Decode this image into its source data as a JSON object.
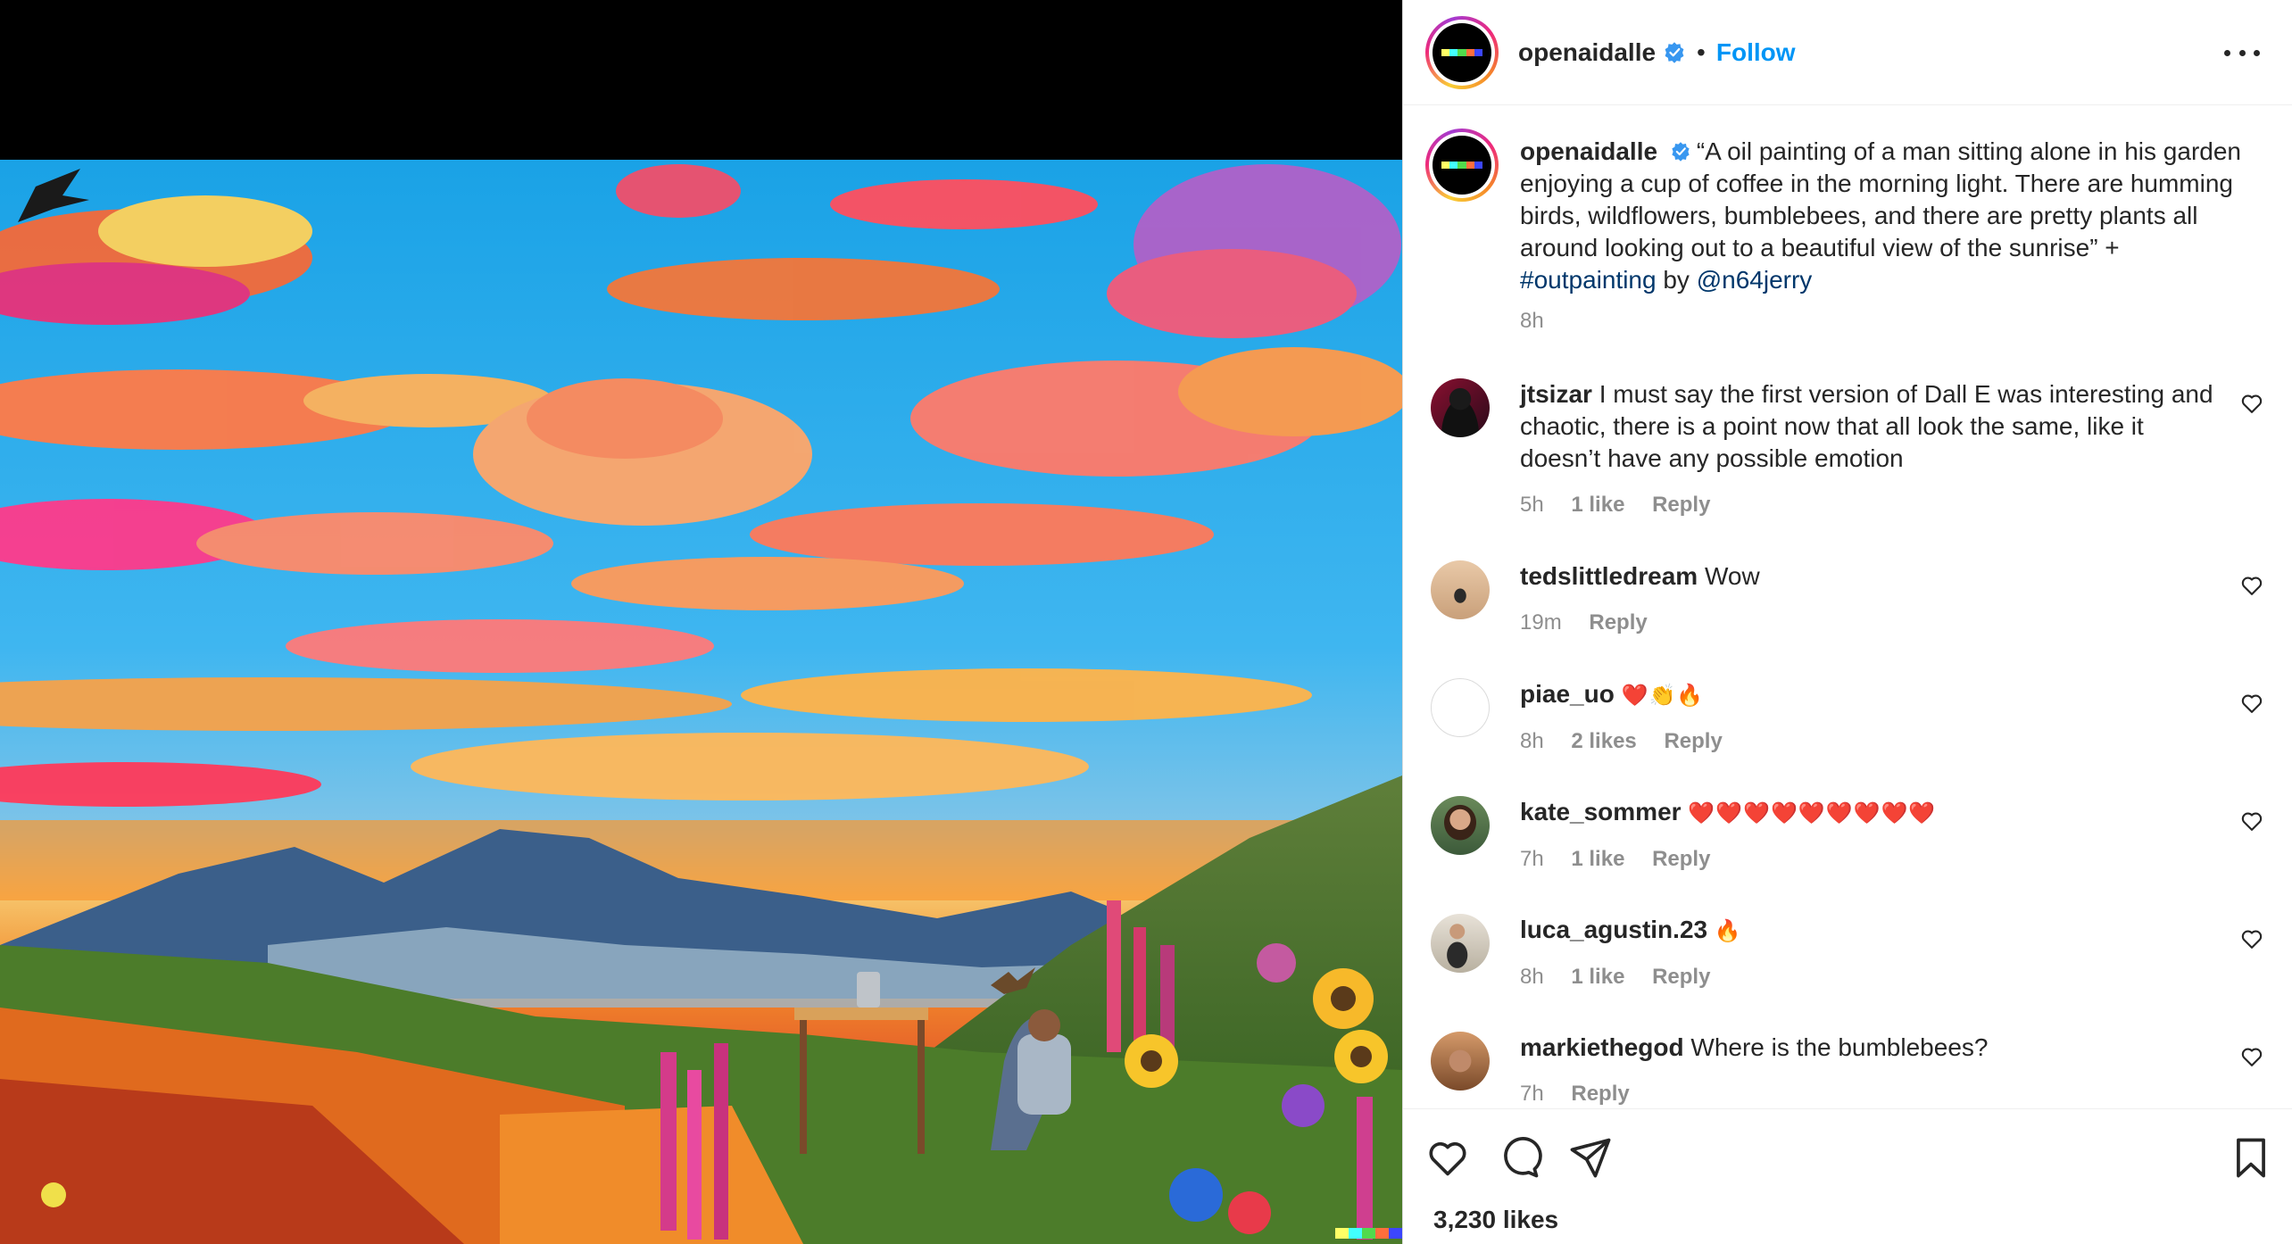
{
  "post": {
    "author": "openaidalle",
    "follow_label": "Follow",
    "separator": "•",
    "caption_text": "“A oil painting of a man sitting alone in his garden enjoying a cup of coffee in the morning light. There are humming birds, wildflowers, bumblebees, and there are pretty plants all around looking out to a beautiful view of the sunrise” + ",
    "hashtag": "#outpainting",
    "by_text": " by ",
    "mention": "@n64jerry",
    "caption_time": "8h",
    "likes_count": "3,230 likes"
  },
  "comments": [
    {
      "user": "jtsizar",
      "text": "I must say the first version of Dall E was interesting and chaotic, there is a point now that all look the same, like it doesn’t have any possible emotion",
      "time": "5h",
      "likes": "1 like",
      "reply": "Reply"
    },
    {
      "user": "tedslittledream",
      "text": "Wow",
      "time": "19m",
      "likes": "",
      "reply": "Reply"
    },
    {
      "user": "piae_uo",
      "text": "❤️👏🔥",
      "time": "8h",
      "likes": "2 likes",
      "reply": "Reply"
    },
    {
      "user": "kate_sommer",
      "text": "❤️❤️❤️❤️❤️❤️❤️❤️❤️",
      "time": "7h",
      "likes": "1 like",
      "reply": "Reply"
    },
    {
      "user": "luca_agustin.23",
      "text": "🔥",
      "time": "8h",
      "likes": "1 like",
      "reply": "Reply"
    },
    {
      "user": "markiethegod",
      "text": "Where is the bumblebees?",
      "time": "7h",
      "likes": "",
      "reply": "Reply"
    }
  ],
  "icons": {
    "verified": "verified-badge-icon",
    "more": "more-options-icon",
    "like": "heart-icon",
    "comment": "comment-icon",
    "share": "share-icon",
    "save": "bookmark-icon"
  },
  "colors": {
    "accent": "#0095f6",
    "link": "#00376b",
    "muted": "#8e8e8e",
    "verified": "#3897f0",
    "text": "#262626"
  }
}
